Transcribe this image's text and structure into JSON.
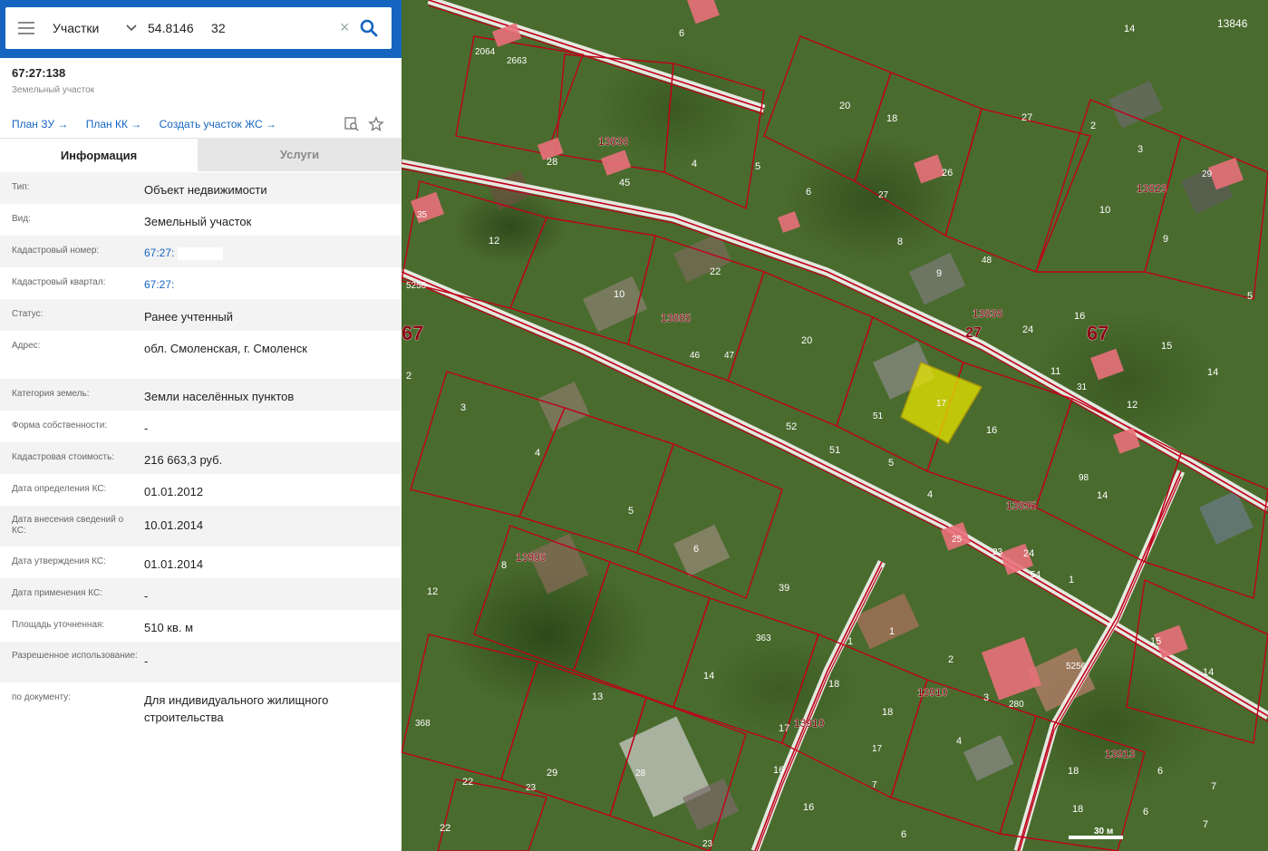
{
  "search": {
    "layer": "Участки",
    "query": "54.8146     32"
  },
  "object": {
    "title": "67:27:138",
    "subtitle": "Земельный участок"
  },
  "links": [
    {
      "label": "План ЗУ →"
    },
    {
      "label": "План КК →"
    },
    {
      "label": "Создать участок ЖС →"
    }
  ],
  "tabs": {
    "info": "Информация",
    "services": "Услуги"
  },
  "rows": [
    {
      "label": "Тип:",
      "value": "Объект недвижимости"
    },
    {
      "label": "Вид:",
      "value": "Земельный участок"
    },
    {
      "label": "Кадастровый номер:",
      "value": "67:27:"
    },
    {
      "label": "Кадастровый квартал:",
      "value": "67:27:"
    },
    {
      "label": "Статус:",
      "value": "Ранее учтенный"
    },
    {
      "label": "Адрес:",
      "value": "обл. Смоленская, г. Смоленск"
    },
    {
      "label": "Категория земель:",
      "value": "Земли населённых пунктов"
    },
    {
      "label": "Форма собственности:",
      "value": "-"
    },
    {
      "label": "Кадастровая стоимость:",
      "value": "216 663,3 руб."
    },
    {
      "label": "Дата определения КС:",
      "value": "01.01.2012"
    },
    {
      "label": "Дата внесения сведений о КС:",
      "value": "10.01.2014"
    },
    {
      "label": "Дата утверждения КС:",
      "value": "01.01.2014"
    },
    {
      "label": "Дата применения КС:",
      "value": "-"
    },
    {
      "label": "Площадь уточненная:",
      "value": "510 кв. м"
    },
    {
      "label": "Разрешенное использование:",
      "value": "-"
    },
    {
      "label": "по документу:",
      "value": "Для индивидуального жилищного строительства"
    }
  ],
  "map": {
    "scale_label": "30 м",
    "selected_label": "17",
    "colors": {
      "boundary": "#c0001a",
      "selected": "#e8e600",
      "building": "#e8707a"
    },
    "labels": [
      {
        "t": "67"
      },
      {
        "t": "27"
      },
      {
        "t": "67"
      },
      {
        "t": "13836"
      },
      {
        "t": "13836"
      },
      {
        "t": "13823"
      },
      {
        "t": "13885"
      },
      {
        "t": "13905"
      },
      {
        "t": "13835"
      },
      {
        "t": "13910"
      },
      {
        "t": "13910"
      },
      {
        "t": "13913"
      },
      {
        "t": "5256"
      },
      {
        "t": "5256"
      },
      {
        "t": "2064"
      },
      {
        "t": "2663"
      },
      {
        "t": "13846"
      },
      {
        "t": "20"
      },
      {
        "t": "18"
      },
      {
        "t": "26"
      },
      {
        "t": "27"
      },
      {
        "t": "14"
      },
      {
        "t": "2"
      },
      {
        "t": "3"
      },
      {
        "t": "10"
      },
      {
        "t": "9"
      },
      {
        "t": "29"
      },
      {
        "t": "5"
      },
      {
        "t": "28"
      },
      {
        "t": "45"
      },
      {
        "t": "4"
      },
      {
        "t": "5"
      },
      {
        "t": "6"
      },
      {
        "t": "27"
      },
      {
        "t": "8"
      },
      {
        "t": "9"
      },
      {
        "t": "48"
      },
      {
        "t": "24"
      },
      {
        "t": "16"
      },
      {
        "t": "12"
      },
      {
        "t": "22"
      },
      {
        "t": "10"
      },
      {
        "t": "46"
      },
      {
        "t": "47"
      },
      {
        "t": "20"
      },
      {
        "t": "11"
      },
      {
        "t": "31"
      },
      {
        "t": "15"
      },
      {
        "t": "14"
      },
      {
        "t": "3"
      },
      {
        "t": "4"
      },
      {
        "t": "52"
      },
      {
        "t": "51"
      },
      {
        "t": "51"
      },
      {
        "t": "5"
      },
      {
        "t": "16"
      },
      {
        "t": "12"
      },
      {
        "t": "98"
      },
      {
        "t": "14"
      },
      {
        "t": "5"
      },
      {
        "t": "6"
      },
      {
        "t": "8"
      },
      {
        "t": "12"
      },
      {
        "t": "39"
      },
      {
        "t": "4"
      },
      {
        "t": "25"
      },
      {
        "t": "23"
      },
      {
        "t": "24"
      },
      {
        "t": "54"
      },
      {
        "t": "1"
      },
      {
        "t": "363"
      },
      {
        "t": "1"
      },
      {
        "t": "1"
      },
      {
        "t": "2"
      },
      {
        "t": "15"
      },
      {
        "t": "14"
      },
      {
        "t": "13"
      },
      {
        "t": "14"
      },
      {
        "t": "18"
      },
      {
        "t": "18"
      },
      {
        "t": "3"
      },
      {
        "t": "280"
      },
      {
        "t": "368"
      },
      {
        "t": "17"
      },
      {
        "t": "17"
      },
      {
        "t": "4"
      },
      {
        "t": "18"
      },
      {
        "t": "6"
      },
      {
        "t": "7"
      },
      {
        "t": "29"
      },
      {
        "t": "23"
      },
      {
        "t": "22"
      },
      {
        "t": "22"
      },
      {
        "t": "28"
      },
      {
        "t": "16"
      },
      {
        "t": "16"
      },
      {
        "t": "7"
      },
      {
        "t": "6"
      },
      {
        "t": "18"
      },
      {
        "t": "6"
      },
      {
        "t": "7"
      },
      {
        "t": "23"
      },
      {
        "t": "35"
      },
      {
        "t": "12"
      },
      {
        "t": "6"
      },
      {
        "t": "10"
      },
      {
        "t": "2"
      }
    ]
  }
}
